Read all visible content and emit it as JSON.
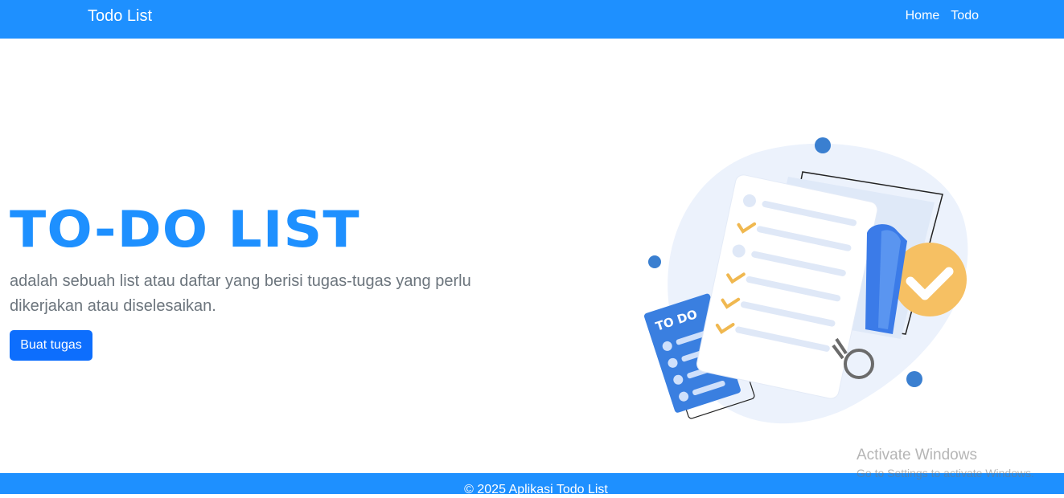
{
  "colors": {
    "primary": "#1e90ff",
    "button": "#0d6efd",
    "text_muted": "#6c757d",
    "white": "#ffffff"
  },
  "navbar": {
    "brand": "Todo List",
    "links": [
      {
        "label": "Home"
      },
      {
        "label": "Todo"
      }
    ]
  },
  "hero": {
    "title": "TO-DO LIST",
    "description": "adalah sebuah list atau daftar yang berisi tugas-tugas yang perlu dikerjakan atau diselesaikan.",
    "cta_label": "Buat tugas",
    "illustration": {
      "icon": "todo-checklist-illustration",
      "card_text": "TO DO"
    }
  },
  "footer": {
    "text": "© 2025 Aplikasi Todo List"
  },
  "os_watermark": {
    "title": "Activate Windows",
    "subtitle": "Go to Settings to activate Windows."
  }
}
